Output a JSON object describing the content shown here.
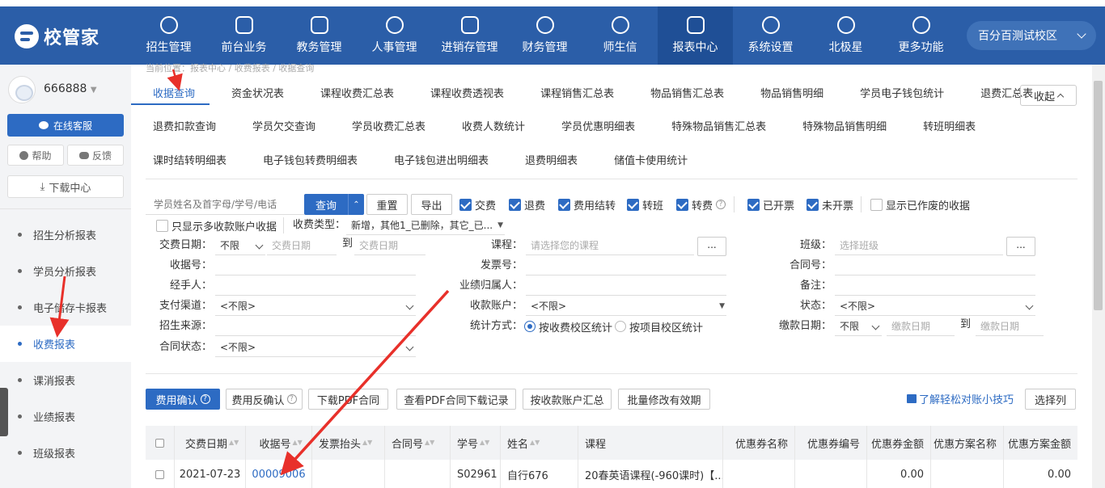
{
  "brand": {
    "logo_text": "校管家",
    "accent": "#2b5ea8"
  },
  "nav": [
    {
      "label": "招生管理",
      "icon": "user-add-icon"
    },
    {
      "label": "前台业务",
      "icon": "monitor-icon"
    },
    {
      "label": "教务管理",
      "icon": "book-icon"
    },
    {
      "label": "人事管理",
      "icon": "person-icon"
    },
    {
      "label": "进销存管理",
      "icon": "box-arrow-icon"
    },
    {
      "label": "财务管理",
      "icon": "money-bag-icon"
    },
    {
      "label": "师生信",
      "icon": "chat-icon"
    },
    {
      "label": "报表中心",
      "icon": "bar-chart-icon"
    },
    {
      "label": "系统设置",
      "icon": "gear-icon"
    },
    {
      "label": "北极星",
      "icon": "star-icon"
    },
    {
      "label": "更多功能",
      "icon": "more-icon"
    }
  ],
  "campus": {
    "label": "百分百测试校区"
  },
  "sidebar": {
    "username": "666888",
    "service_label": "在线客服",
    "help_label": "帮助",
    "feedback_label": "反馈",
    "download_label": "下载中心",
    "items": [
      {
        "label": "招生分析报表"
      },
      {
        "label": "学员分析报表"
      },
      {
        "label": "电子储存卡报表"
      },
      {
        "label": "收费报表"
      },
      {
        "label": "课消报表"
      },
      {
        "label": "业绩报表"
      },
      {
        "label": "班级报表"
      }
    ]
  },
  "breadcrumb": "当前位置：报表中心 / 收费报表 / 收据查询",
  "tabs": {
    "row1": [
      "收据查询",
      "资金状况表",
      "课程收费汇总表",
      "课程收费透视表",
      "课程销售汇总表",
      "物品销售汇总表",
      "物品销售明细",
      "学员电子钱包统计",
      "退费汇总表"
    ],
    "row2": [
      "退费扣款查询",
      "学员欠交查询",
      "学员收费汇总表",
      "收费人数统计",
      "学员优惠明细表",
      "特殊物品销售汇总表",
      "特殊物品销售明细",
      "转班明细表"
    ],
    "row3": [
      "课时结转明细表",
      "电子钱包转费明细表",
      "电子钱包进出明细表",
      "退费明细表",
      "储值卡使用统计"
    ],
    "collapse_label": "收起"
  },
  "filters": {
    "search_placeholder": "学员姓名及首字母/学号/电话",
    "query_label": "查询",
    "reset_label": "重置",
    "export_label": "导出",
    "checks": [
      {
        "label": "交费",
        "checked": true
      },
      {
        "label": "退费",
        "checked": true
      },
      {
        "label": "费用结转",
        "checked": true
      },
      {
        "label": "转班",
        "checked": true
      },
      {
        "label": "转费",
        "checked": true
      },
      {
        "label": "已开票",
        "checked": true
      },
      {
        "label": "未开票",
        "checked": true
      },
      {
        "label": "显示已作废的收据",
        "checked": false
      },
      {
        "label": "只显示多收款账户收据",
        "checked": false
      }
    ],
    "fee_type_label": "收费类型：",
    "fee_type_value": "新增，其他1_已删除，其它_已...",
    "pay_date_label": "交费日期：",
    "pay_date_mode": "不限",
    "pay_date_from": "交费日期",
    "to_label": "到",
    "pay_date_to": "交费日期",
    "course_label": "课程：",
    "course_placeholder": "请选择您的课程",
    "more_btn": "...",
    "class_label": "班级：",
    "class_placeholder": "选择班级",
    "receipt_no_label": "收据号：",
    "invoice_no_label": "发票号：",
    "contract_no_label": "合同号：",
    "handler_label": "经手人：",
    "performance_label": "业绩归属人：",
    "remark_label": "备注：",
    "pay_channel_label": "支付渠道：",
    "pay_channel_value": "<不限>",
    "account_label": "收款账户：",
    "account_value": "<不限>",
    "status_label": "状态：",
    "status_value": "<不限>",
    "source_label": "招生来源：",
    "stat_mode_label": "统计方式：",
    "stat_mode_1": "按收费校区统计",
    "stat_mode_2": "按项目校区统计",
    "due_date_label": "缴款日期：",
    "due_date_mode": "不限",
    "due_date_from": "缴款日期",
    "due_date_to": "缴款日期",
    "contract_status_label": "合同状态：",
    "contract_status_value": "<不限>"
  },
  "actions": {
    "confirm_label": "费用确认",
    "unconfirm_label": "费用反确认",
    "download_pdf_label": "下载PDF合同",
    "view_pdf_label": "查看PDF合同下载记录",
    "summary_label": "按收款账户汇总",
    "batch_label": "批量修改有效期",
    "tip_label": "了解轻松对账小技巧",
    "columns_label": "选择列"
  },
  "table": {
    "headers": [
      "交费日期",
      "收据号",
      "发票抬头",
      "合同号",
      "学号",
      "姓名",
      "课程",
      "优惠券名称",
      "优惠券编号",
      "优惠券金额",
      "优惠方案名称",
      "优惠方案金额"
    ],
    "rows": [
      {
        "date": "2021-07-23",
        "receipt": "00009006",
        "invoice": "",
        "contract": "",
        "student_no": "S02961",
        "name": "自行676",
        "course": "20春英语课程(-960课时)【...",
        "coupon_name": "",
        "coupon_no": "",
        "coupon_amount": "0.00",
        "plan_name": "",
        "plan_amount": "0.00"
      }
    ]
  }
}
